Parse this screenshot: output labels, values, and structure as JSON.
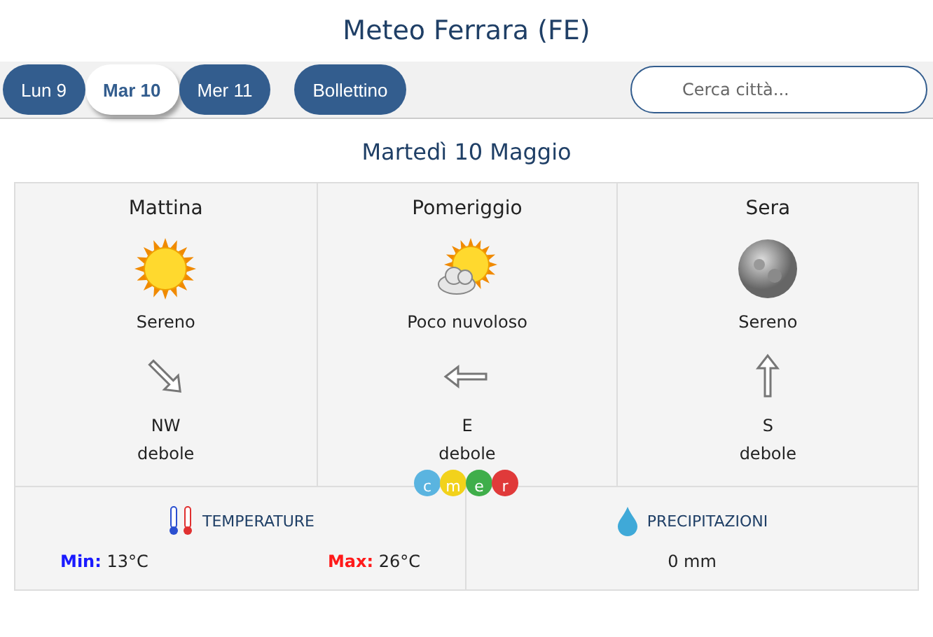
{
  "title": "Meteo Ferrara (FE)",
  "tabs": [
    {
      "label": "Lun 9",
      "selected": false
    },
    {
      "label": "Mar 10",
      "selected": true
    },
    {
      "label": "Mer 11",
      "selected": false
    }
  ],
  "bulletin_button": "Bollettino",
  "search": {
    "placeholder": "Cerca città..."
  },
  "date": "Martedì 10 Maggio",
  "periods": [
    {
      "name": "Mattina",
      "kind": "sun",
      "condition": "Sereno",
      "wind_dir": "NW",
      "wind_strength": "debole"
    },
    {
      "name": "Pomeriggio",
      "kind": "suncloud",
      "condition": "Poco nuvoloso",
      "wind_dir": "E",
      "wind_strength": "debole"
    },
    {
      "name": "Sera",
      "kind": "moon",
      "condition": "Sereno",
      "wind_dir": "S",
      "wind_strength": "debole"
    }
  ],
  "logo": [
    {
      "letter": "c",
      "color": "#5ab4e0"
    },
    {
      "letter": "m",
      "color": "#f2d21b"
    },
    {
      "letter": "e",
      "color": "#3fae4a"
    },
    {
      "letter": "r",
      "color": "#e03a3a"
    }
  ],
  "temperature": {
    "heading": "TEMPERATURE",
    "min_label": "Min:",
    "min": "13°C",
    "max_label": "Max:",
    "max": "26°C"
  },
  "precipitation": {
    "heading": "PRECIPITAZIONI",
    "value": "0 mm"
  }
}
